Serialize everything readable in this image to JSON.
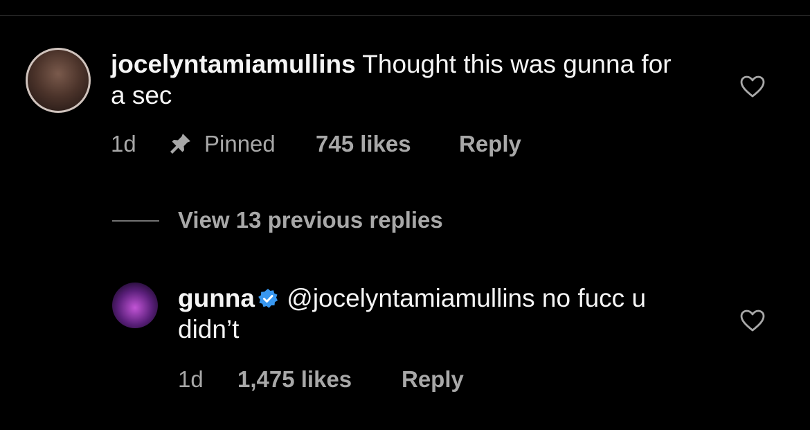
{
  "comments": [
    {
      "username": "jocelyntamiamullins",
      "text": " Thought this was gunna for a sec",
      "time": "1d",
      "pinned_label": "Pinned",
      "likes": "745 likes",
      "reply_label": "Reply",
      "avatar_icon": "profile-photo"
    },
    {
      "username": "gunna",
      "verified": true,
      "text": " @jocelyntamiamullins no fucc u didn’t",
      "time": "1d",
      "likes": "1,475 likes",
      "reply_label": "Reply",
      "avatar_icon": "profile-photo"
    }
  ],
  "thread": {
    "view_replies_label": "View 13 previous replies"
  },
  "colors": {
    "background": "#000000",
    "primary_text": "#f5f5f5",
    "secondary_text": "#a8a8a8",
    "verified_blue": "#3897f0"
  }
}
